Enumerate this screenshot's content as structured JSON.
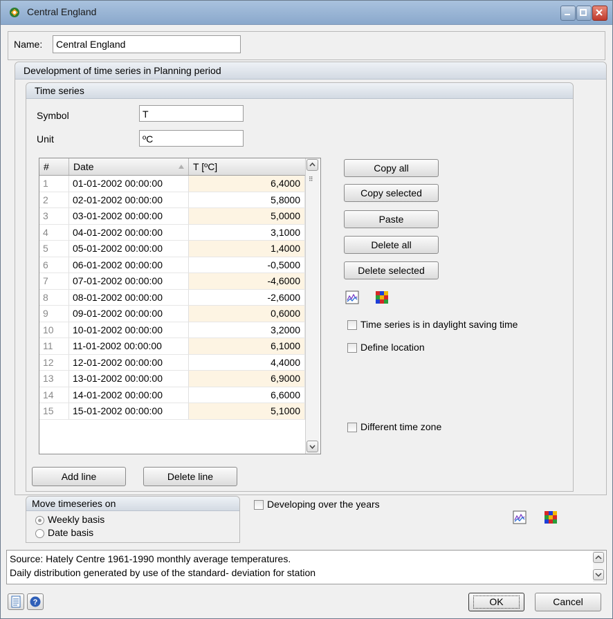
{
  "window": {
    "title": "Central England"
  },
  "name_field": {
    "label": "Name:",
    "value": "Central England"
  },
  "development_panel": {
    "title": "Development of time series in Planning period"
  },
  "time_series": {
    "title": "Time series",
    "symbol_label": "Symbol",
    "symbol_value": "T",
    "unit_label": "Unit",
    "unit_value": "ºC",
    "columns": [
      "#",
      "Date",
      "T [ºC]"
    ],
    "rows": [
      {
        "n": "1",
        "date": "01-01-2002 00:00:00",
        "value": "6,4000"
      },
      {
        "n": "2",
        "date": "02-01-2002 00:00:00",
        "value": "5,8000"
      },
      {
        "n": "3",
        "date": "03-01-2002 00:00:00",
        "value": "5,0000"
      },
      {
        "n": "4",
        "date": "04-01-2002 00:00:00",
        "value": "3,1000"
      },
      {
        "n": "5",
        "date": "05-01-2002 00:00:00",
        "value": "1,4000"
      },
      {
        "n": "6",
        "date": "06-01-2002 00:00:00",
        "value": "-0,5000"
      },
      {
        "n": "7",
        "date": "07-01-2002 00:00:00",
        "value": "-4,6000"
      },
      {
        "n": "8",
        "date": "08-01-2002 00:00:00",
        "value": "-2,6000"
      },
      {
        "n": "9",
        "date": "09-01-2002 00:00:00",
        "value": "0,6000"
      },
      {
        "n": "10",
        "date": "10-01-2002 00:00:00",
        "value": "3,2000"
      },
      {
        "n": "11",
        "date": "11-01-2002 00:00:00",
        "value": "6,1000"
      },
      {
        "n": "12",
        "date": "12-01-2002 00:00:00",
        "value": "4,4000"
      },
      {
        "n": "13",
        "date": "13-01-2002 00:00:00",
        "value": "6,9000"
      },
      {
        "n": "14",
        "date": "14-01-2002 00:00:00",
        "value": "6,6000"
      },
      {
        "n": "15",
        "date": "15-01-2002 00:00:00",
        "value": "5,1000"
      }
    ],
    "buttons": {
      "copy_all": "Copy all",
      "copy_selected": "Copy selected",
      "paste": "Paste",
      "delete_all": "Delete all",
      "delete_selected": "Delete selected",
      "add_line": "Add line",
      "delete_line": "Delete line"
    },
    "checkboxes": {
      "daylight_saving": "Time series is in daylight saving time",
      "define_location": "Define location",
      "different_time_zone": "Different time zone"
    }
  },
  "move_timeseries": {
    "title": "Move timeseries on",
    "options": [
      "Weekly basis",
      "Date basis"
    ],
    "selected": "Weekly basis"
  },
  "developing_checkbox": "Developing over the years",
  "source_text": {
    "line1": "Source: Hately Centre 1961-1990 monthly average temperatures.",
    "line2": "Daily distribution generated by use of the standard- deviation for station"
  },
  "footer": {
    "ok": "OK",
    "cancel": "Cancel"
  },
  "colors": {
    "row_stripe": "#fdf4e3",
    "title_bar": "#a9c2de"
  }
}
